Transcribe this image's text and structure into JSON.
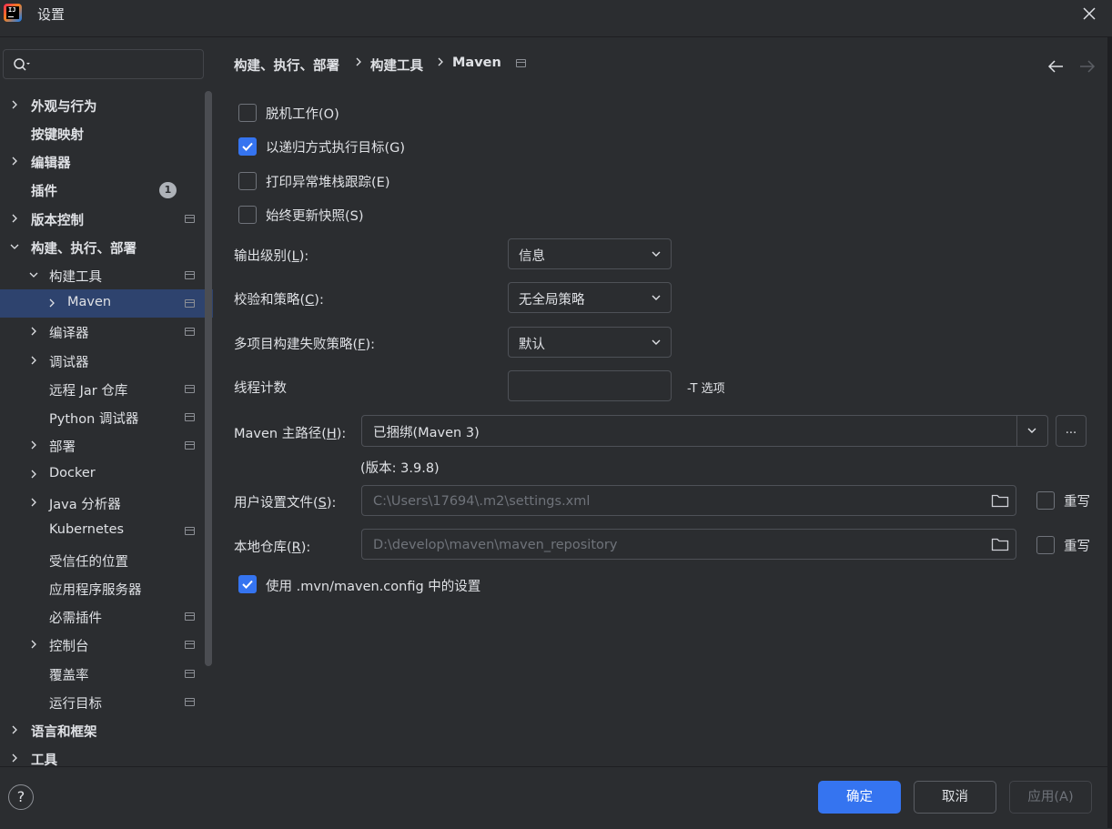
{
  "window": {
    "title": "设置"
  },
  "search": {
    "placeholder": "",
    "value": ""
  },
  "sidebar": {
    "items": [
      {
        "label": "外观与行为",
        "bold": true,
        "expandable": true,
        "expanded": false,
        "indent": 0
      },
      {
        "label": "按键映射",
        "bold": true,
        "expandable": false,
        "indent": 0
      },
      {
        "label": "编辑器",
        "bold": true,
        "expandable": true,
        "expanded": false,
        "indent": 0
      },
      {
        "label": "插件",
        "bold": true,
        "expandable": false,
        "indent": 0,
        "badge": "1"
      },
      {
        "label": "版本控制",
        "bold": true,
        "expandable": true,
        "expanded": false,
        "indent": 0,
        "project_icon": true
      },
      {
        "label": "构建、执行、部署",
        "bold": true,
        "expandable": true,
        "expanded": true,
        "indent": 0
      },
      {
        "label": "构建工具",
        "bold": false,
        "expandable": true,
        "expanded": true,
        "indent": 1,
        "project_icon": true
      },
      {
        "label": "Maven",
        "bold": false,
        "expandable": true,
        "expanded": false,
        "indent": 2,
        "project_icon": true,
        "selected": true
      },
      {
        "label": "编译器",
        "bold": false,
        "expandable": true,
        "expanded": false,
        "indent": 1,
        "project_icon": true
      },
      {
        "label": "调试器",
        "bold": false,
        "expandable": true,
        "expanded": false,
        "indent": 1
      },
      {
        "label": "远程 Jar 仓库",
        "bold": false,
        "expandable": false,
        "indent": 1,
        "project_icon": true
      },
      {
        "label": "Python 调试器",
        "bold": false,
        "expandable": false,
        "indent": 1,
        "project_icon": true
      },
      {
        "label": "部署",
        "bold": false,
        "expandable": true,
        "expanded": false,
        "indent": 1,
        "project_icon": true
      },
      {
        "label": "Docker",
        "bold": false,
        "expandable": true,
        "expanded": false,
        "indent": 1
      },
      {
        "label": "Java 分析器",
        "bold": false,
        "expandable": true,
        "expanded": false,
        "indent": 1
      },
      {
        "label": "Kubernetes",
        "bold": false,
        "expandable": false,
        "indent": 1,
        "project_icon": true
      },
      {
        "label": "受信任的位置",
        "bold": false,
        "expandable": false,
        "indent": 1
      },
      {
        "label": "应用程序服务器",
        "bold": false,
        "expandable": false,
        "indent": 1
      },
      {
        "label": "必需插件",
        "bold": false,
        "expandable": false,
        "indent": 1,
        "project_icon": true
      },
      {
        "label": "控制台",
        "bold": false,
        "expandable": true,
        "expanded": false,
        "indent": 1,
        "project_icon": true
      },
      {
        "label": "覆盖率",
        "bold": false,
        "expandable": false,
        "indent": 1,
        "project_icon": true
      },
      {
        "label": "运行目标",
        "bold": false,
        "expandable": false,
        "indent": 1,
        "project_icon": true
      },
      {
        "label": "语言和框架",
        "bold": true,
        "expandable": true,
        "expanded": false,
        "indent": 0
      },
      {
        "label": "工具",
        "bold": true,
        "expandable": true,
        "expanded": false,
        "indent": 0
      }
    ]
  },
  "breadcrumb": [
    "构建、执行、部署",
    "构建工具",
    "Maven"
  ],
  "options": {
    "offline": {
      "label": "脱机工作(O)",
      "checked": false
    },
    "recursive": {
      "label": "以递归方式执行目标(G)",
      "checked": true
    },
    "print_stack": {
      "label": "打印异常堆栈跟踪(E)",
      "checked": false
    },
    "always_update": {
      "label": "始终更新快照(S)",
      "checked": false
    },
    "use_mvn_config": {
      "label": "使用 .mvn/maven.config 中的设置",
      "checked": true
    }
  },
  "fields": {
    "output_level": {
      "label_pre": "输出级别(",
      "key": "L",
      "label_post": "):",
      "value": "信息"
    },
    "checksum": {
      "label_pre": "校验和策略(",
      "key": "C",
      "label_post": "):",
      "value": "无全局策略"
    },
    "multiproject": {
      "label_pre": "多项目构建失败策略(",
      "key": "F",
      "label_post": "):",
      "value": "默认"
    },
    "threads": {
      "label": "线程计数",
      "value": "",
      "suffix": "-T 选项"
    },
    "maven_home": {
      "label_pre": "Maven 主路径(",
      "key": "H",
      "label_post": "):",
      "value": "已捆绑(Maven 3)",
      "browse": "...",
      "version": "(版本: 3.9.8)"
    },
    "user_settings": {
      "label_pre": "用户设置文件(",
      "key": "S",
      "label_post": "):",
      "value": "C:\\Users\\17694\\.m2\\settings.xml",
      "override_label": "重写",
      "override": false
    },
    "local_repo": {
      "label_pre": "本地仓库(",
      "key": "R",
      "label_post": "):",
      "value": "D:\\develop\\maven\\maven_repository",
      "override_label": "重写",
      "override": false
    }
  },
  "footer": {
    "help": "?",
    "ok": "确定",
    "cancel": "取消",
    "apply": "应用(A)"
  },
  "colors": {
    "accent": "#3574f0",
    "background": "#2b2d30",
    "selection": "#2e436e"
  }
}
